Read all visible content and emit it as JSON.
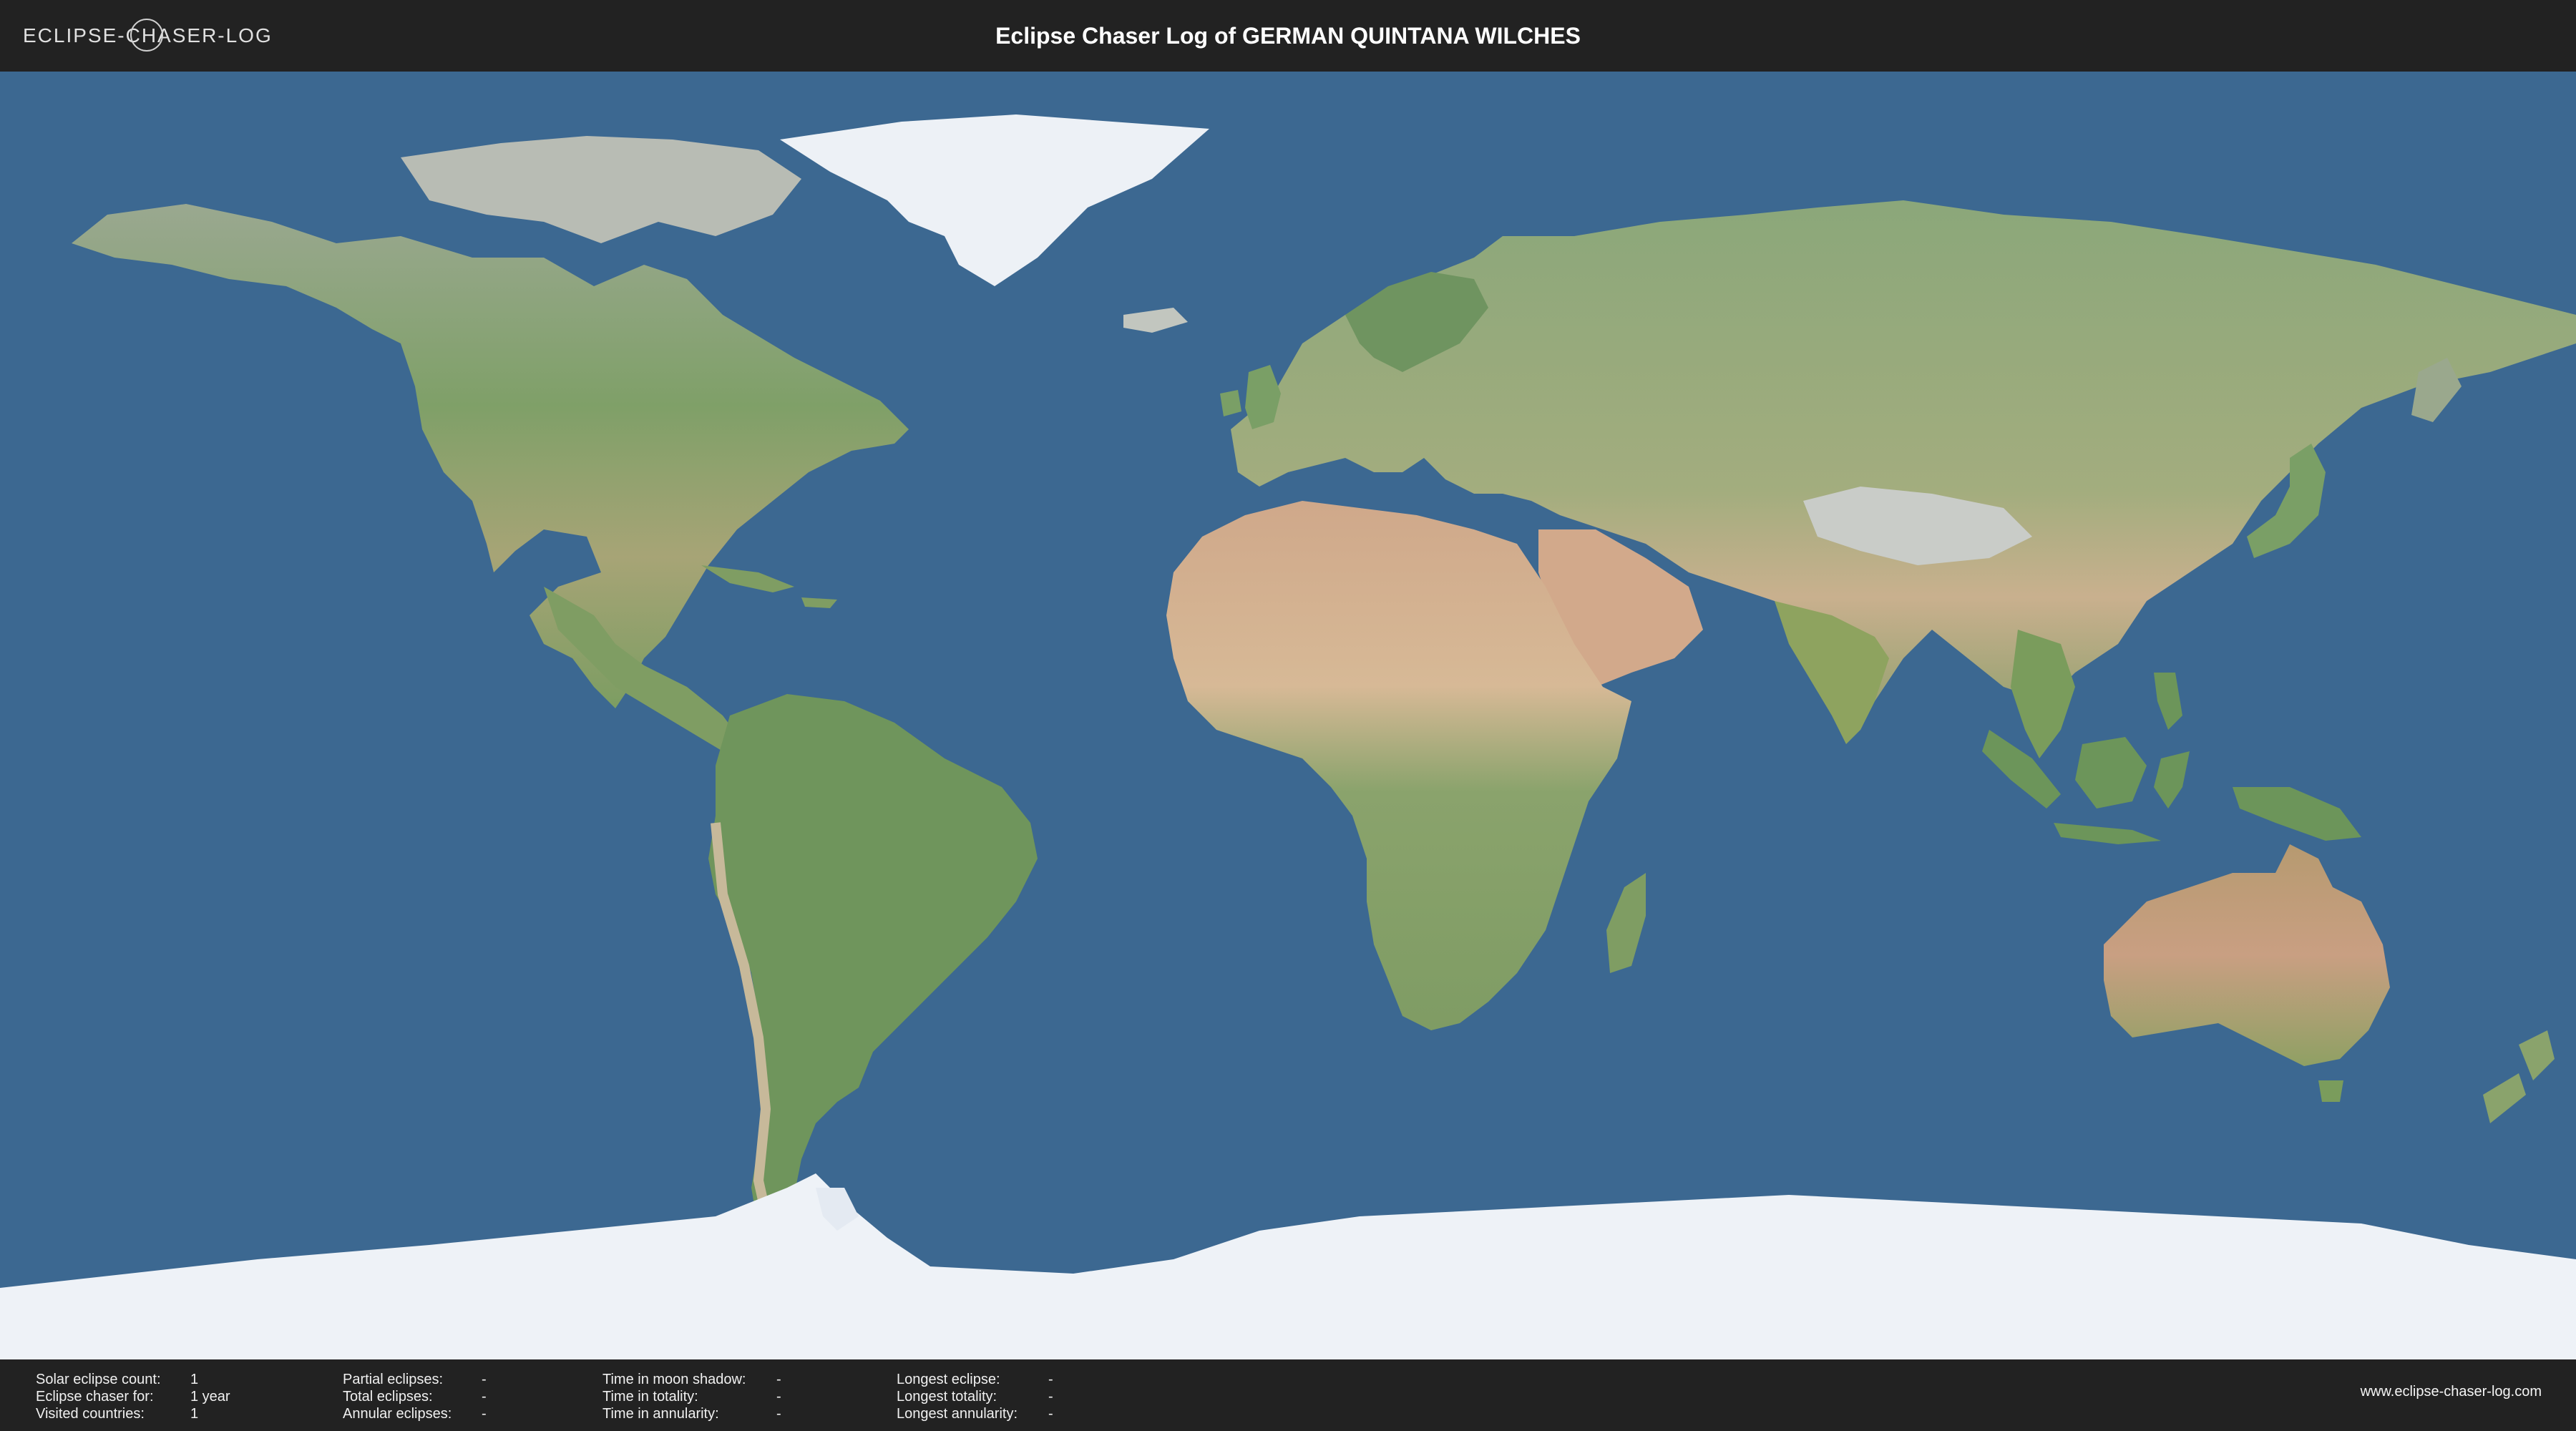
{
  "header": {
    "logo_text": "ECLIPSE-CHASER-LOG",
    "title": "Eclipse Chaser Log of GERMAN QUINTANA WILCHES"
  },
  "map": {
    "ocean_color": "#3c6891",
    "land_color": "#7f9f6a",
    "desert_color": "#c8a784",
    "ice_color": "#eef2f7"
  },
  "footer": {
    "stats": [
      [
        {
          "label": "Solar eclipse count:",
          "value": "1"
        },
        {
          "label": "Eclipse chaser for:",
          "value": "1 year"
        },
        {
          "label": "Visited countries:",
          "value": "1"
        }
      ],
      [
        {
          "label": "Partial eclipses:",
          "value": "-"
        },
        {
          "label": "Total eclipses:",
          "value": "-"
        },
        {
          "label": "Annular eclipses:",
          "value": "-"
        }
      ],
      [
        {
          "label": "Time in moon shadow:",
          "value": "-"
        },
        {
          "label": "Time in totality:",
          "value": "-"
        },
        {
          "label": "Time in annularity:",
          "value": "-"
        }
      ],
      [
        {
          "label": "Longest eclipse:",
          "value": "-"
        },
        {
          "label": "Longest totality:",
          "value": "-"
        },
        {
          "label": "Longest annularity:",
          "value": "-"
        }
      ]
    ],
    "website": "www.eclipse-chaser-log.com"
  }
}
